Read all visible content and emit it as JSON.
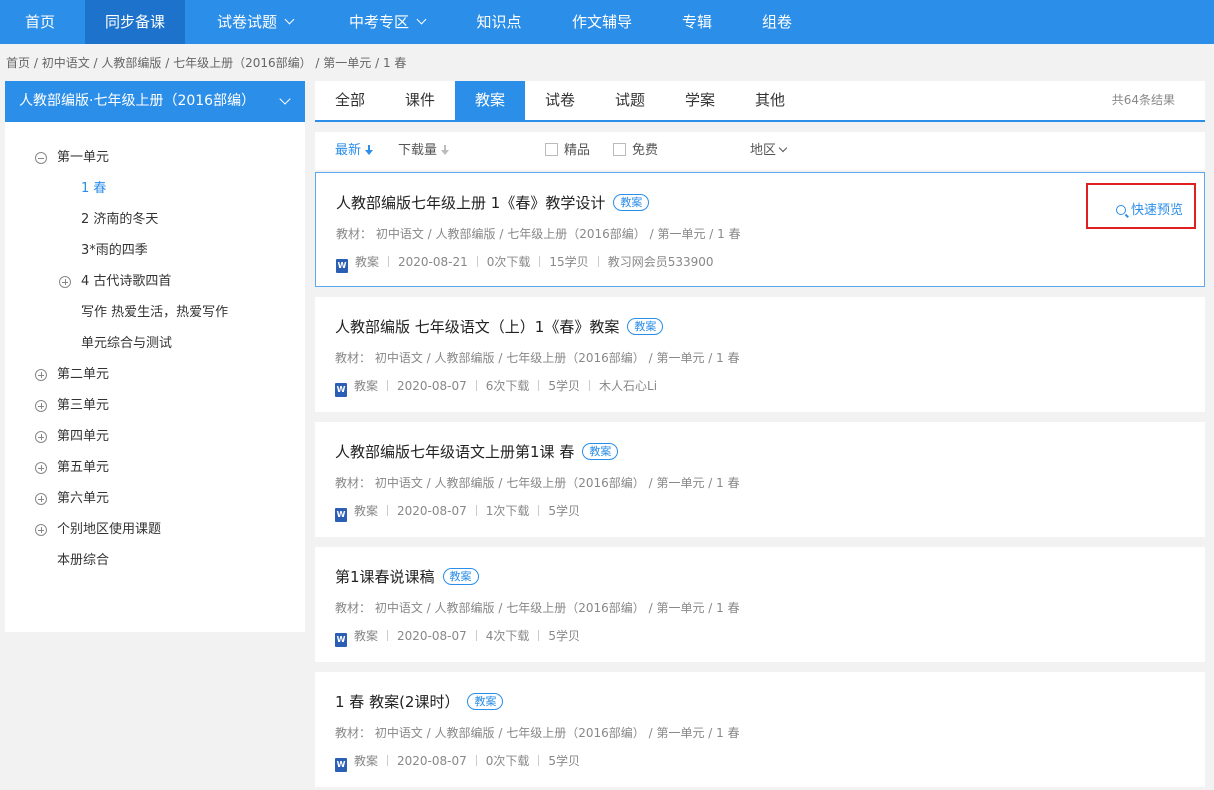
{
  "nav": {
    "items": [
      {
        "label": "首页"
      },
      {
        "label": "同步备课"
      },
      {
        "label": "试卷试题"
      },
      {
        "label": "中考专区"
      },
      {
        "label": "知识点"
      },
      {
        "label": "作文辅导"
      },
      {
        "label": "专辑"
      },
      {
        "label": "组卷"
      }
    ],
    "active": "同步备课"
  },
  "breadcrumb": [
    "首页",
    "初中语文",
    "人教部编版",
    "七年级上册（2016部编）",
    "第一单元",
    "1 春"
  ],
  "sidebar": {
    "book": "人教部编版·七年级上册（2016部编）",
    "tree": [
      {
        "label": "第一单元",
        "expanded": true
      },
      {
        "label": "1 春",
        "current": true
      },
      {
        "label": "2 济南的冬天"
      },
      {
        "label": "3*雨的四季"
      },
      {
        "label": "4 古代诗歌四首",
        "expandable": true
      },
      {
        "label": "写作 热爱生活，热爱写作"
      },
      {
        "label": "单元综合与测试"
      },
      {
        "label": "第二单元",
        "expandable": true
      },
      {
        "label": "第三单元",
        "expandable": true
      },
      {
        "label": "第四单元",
        "expandable": true
      },
      {
        "label": "第五单元",
        "expandable": true
      },
      {
        "label": "第六单元",
        "expandable": true
      },
      {
        "label": "个别地区使用课题",
        "expandable": true
      },
      {
        "label": "本册综合"
      }
    ]
  },
  "tabs": {
    "items": [
      {
        "label": "全部"
      },
      {
        "label": "课件"
      },
      {
        "label": "教案"
      },
      {
        "label": "试卷"
      },
      {
        "label": "试题"
      },
      {
        "label": "学案"
      },
      {
        "label": "其他"
      }
    ],
    "active": "教案",
    "result_count": "共64条结果"
  },
  "filters": {
    "sort_newest": "最新",
    "sort_downloads": "下载量",
    "check_quality": "精品",
    "check_free": "免费",
    "region": "地区"
  },
  "colors": {
    "accent": "#2b8ee8",
    "highlight_box": "#e02020"
  },
  "results": [
    {
      "title": "人教部编版七年级上册 1《春》教学设计",
      "tag": "教案",
      "meta": [
        "教材：",
        "初中语文",
        "人教部编版",
        "七年级上册（2016部编）",
        "第一单元",
        "1 春"
      ],
      "stats": [
        "教案",
        "2020-08-21",
        "0次下载",
        "15学贝",
        "教习网会员533900"
      ],
      "preview": "快速预览"
    },
    {
      "title": "人教部编版 七年级语文（上）1《春》教案",
      "tag": "教案",
      "meta": [
        "教材：",
        "初中语文",
        "人教部编版",
        "七年级上册（2016部编）",
        "第一单元",
        "1 春"
      ],
      "stats": [
        "教案",
        "2020-08-07",
        "6次下载",
        "5学贝",
        "木人石心Li"
      ]
    },
    {
      "title": "人教部编版七年级语文上册第1课 春",
      "tag": "教案",
      "meta": [
        "教材：",
        "初中语文",
        "人教部编版",
        "七年级上册（2016部编）",
        "第一单元",
        "1 春"
      ],
      "stats": [
        "教案",
        "2020-08-07",
        "1次下载",
        "5学贝"
      ]
    },
    {
      "title": "第1课春说课稿",
      "tag": "教案",
      "meta": [
        "教材：",
        "初中语文",
        "人教部编版",
        "七年级上册（2016部编）",
        "第一单元",
        "1 春"
      ],
      "stats": [
        "教案",
        "2020-08-07",
        "4次下载",
        "5学贝"
      ]
    },
    {
      "title": "1 春 教案(2课时）",
      "tag": "教案",
      "meta": [
        "教材：",
        "初中语文",
        "人教部编版",
        "七年级上册（2016部编）",
        "第一单元",
        "1 春"
      ],
      "stats": [
        "教案",
        "2020-08-07",
        "0次下载",
        "5学贝"
      ]
    }
  ]
}
